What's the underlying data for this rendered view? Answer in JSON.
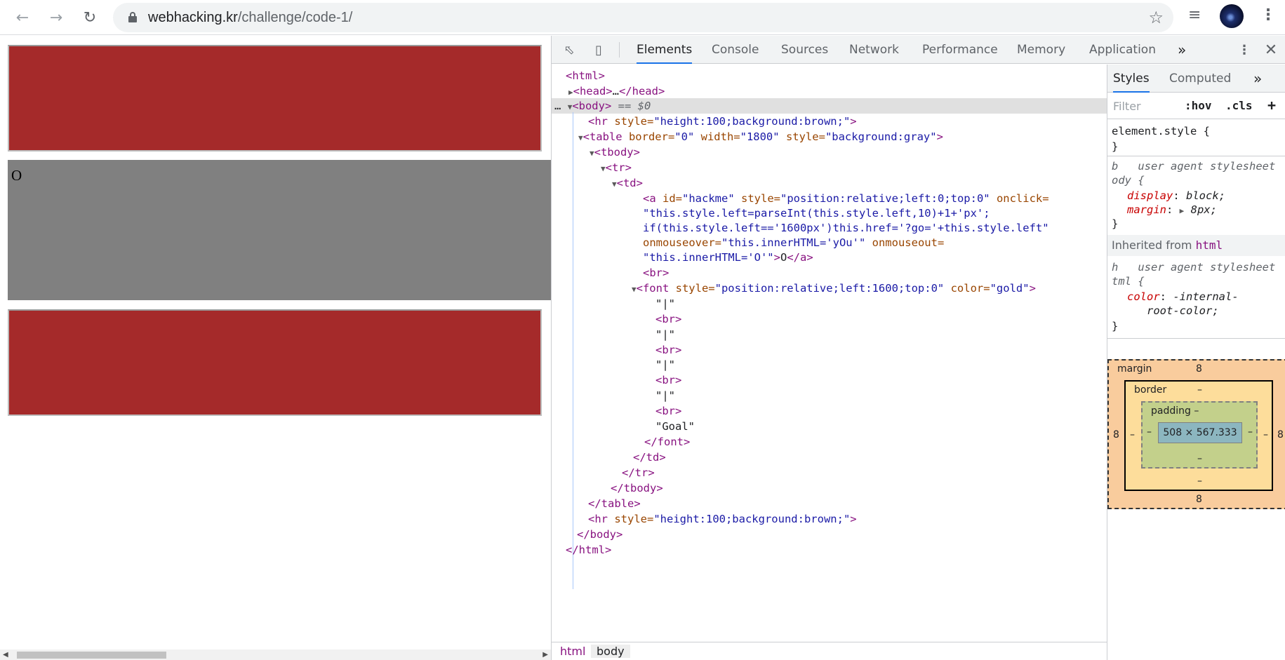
{
  "browser": {
    "url_host": "webhacking.kr",
    "url_path": "/challenge/code-1/"
  },
  "page": {
    "link_text": "O"
  },
  "devtools": {
    "tabs": [
      "Elements",
      "Console",
      "Sources",
      "Network",
      "Performance",
      "Memory",
      "Application"
    ],
    "more_tabs": "»",
    "elements": {
      "lines": {
        "l1": "<html>",
        "l2_open": "<head>",
        "l2_ellipsis": "…",
        "l2_close": "</head>",
        "l3_dots": "…",
        "l3_tag": "<body>",
        "l3_eq": " == $0",
        "l4_tag": "<hr",
        "l4_attr": " style=",
        "l4_val": "\"height:100;background:brown;\"",
        "l4_end": ">",
        "l5_tag": "<table",
        "l5_a1": " border=",
        "l5_v1": "\"0\"",
        "l5_a2": " width=",
        "l5_v2": "\"1800\"",
        "l5_a3": " style=",
        "l5_v3": "\"background:gray\"",
        "l5_end": ">",
        "l6": "<tbody>",
        "l7": "<tr>",
        "l8": "<td>",
        "l9_tag": "<a",
        "l9_a1": " id=",
        "l9_v1": "\"hackme\"",
        "l9_a2": " style=",
        "l9_v2": "\"position:relative;left:0;top:0\"",
        "l9_a3": " onclick=",
        "l10": "\"this.style.left=parseInt(this.style.left,10)+1+'px';",
        "l11": "if(this.style.left=='1600px')this.href='?go='+this.style.left\"",
        "l12_a": "onmouseover=",
        "l12_v": "\"this.innerHTML='yOu'\"",
        "l12_a2": " onmouseout=",
        "l13_v": "\"this.innerHTML='O'\"",
        "l13_tag": ">",
        "l13_text": "O",
        "l13_close": "</a>",
        "l14": "<br>",
        "l15_tag": "<font",
        "l15_a1": " style=",
        "l15_v1": "\"position:relative;left:1600;top:0\"",
        "l15_a2": " color=",
        "l15_v2": "\"gold\"",
        "l15_end": ">",
        "pipe": "\"|\"",
        "br": "<br>",
        "goal": "\"Goal\"",
        "font_close": "</font>",
        "td_close": "</td>",
        "tr_close": "</tr>",
        "tbody_close": "</tbody>",
        "table_close": "</table>",
        "hr2_tag": "<hr",
        "hr2_attr": " style=",
        "hr2_val": "\"height:100;background:brown;\"",
        "hr2_end": ">",
        "body_close": "</body>",
        "html_close": "</html>"
      }
    },
    "breadcrumbs": [
      "html",
      "body"
    ],
    "styles": {
      "tabs": [
        "Styles",
        "Computed"
      ],
      "more": "»",
      "filter_placeholder": "Filter",
      "hov": ":hov",
      "cls": ".cls",
      "add": "+",
      "element_style": "element.style {",
      "brace_close": "}",
      "rule1_sel_a": "b",
      "rule1_origin": "user agent stylesheet",
      "rule1_sel_b": "ody {",
      "rule1_prop1": "display",
      "rule1_val1": "block;",
      "rule1_prop2": "margin",
      "rule1_val2": "8px;",
      "inherited_label": "Inherited from",
      "inherited_tag": "html",
      "rule2_sel_a": "h",
      "rule2_origin": "user agent stylesheet",
      "rule2_sel_b": "tml {",
      "rule2_prop1": "color",
      "rule2_val1a": "-internal-",
      "rule2_val1b": "root-color;"
    },
    "box_model": {
      "margin_label": "margin",
      "margin_top": "8",
      "margin_bottom": "8",
      "margin_left": "8",
      "margin_right": "8",
      "border_label": "border",
      "border_top": "–",
      "border_bottom": "–",
      "border_left": "–",
      "border_right": "–",
      "padding_label": "padding –",
      "padding_bottom": "–",
      "padding_left": "–",
      "padding_right": "–",
      "content": "508 × 567.333"
    }
  }
}
